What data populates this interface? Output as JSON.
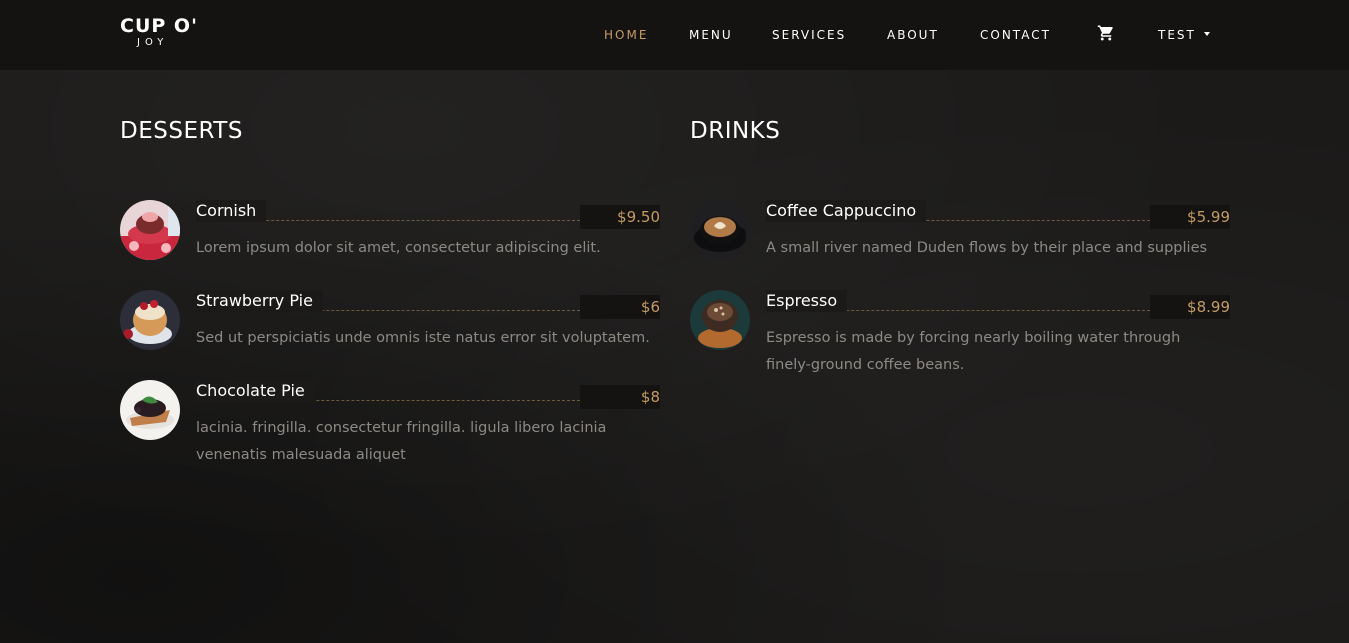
{
  "brand": {
    "line1": "CUP O'",
    "line2": "JOY"
  },
  "nav": {
    "home": "HOME",
    "menu": "MENU",
    "services": "SERVICES",
    "about": "ABOUT",
    "contact": "CONTACT",
    "cart_icon": "shopping-cart-icon",
    "user": "TEST"
  },
  "colors": {
    "accent": "#c49b63",
    "background": "#1b1a19",
    "navbar": "#151312",
    "text_muted": "#8d8a86"
  },
  "desserts": {
    "title": "DESSERTS",
    "items": [
      {
        "name": "Cornish",
        "price": "$9.50",
        "desc": "Lorem ipsum dolor sit amet, consectetur adipiscing elit."
      },
      {
        "name": "Strawberry Pie",
        "price": "$6",
        "desc": "Sed ut perspiciatis unde omnis iste natus error sit voluptatem."
      },
      {
        "name": "Chocolate Pie",
        "price": "$8",
        "desc": "lacinia. fringilla. consectetur fringilla. ligula libero lacinia venenatis malesuada aliquet"
      }
    ]
  },
  "drinks": {
    "title": "DRINKS",
    "items": [
      {
        "name": "Coffee Cappuccino",
        "price": "$5.99",
        "desc": "A small river named Duden flows by their place and supplies"
      },
      {
        "name": "Espresso",
        "price": "$8.99",
        "desc": "Espresso is made by forcing nearly boiling water through finely-ground coffee beans."
      }
    ]
  }
}
